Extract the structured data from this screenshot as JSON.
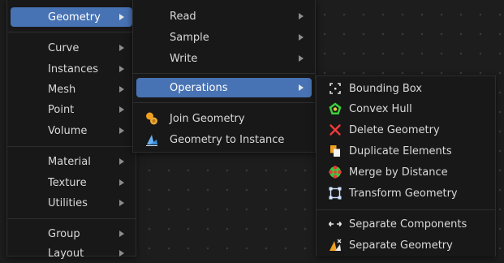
{
  "menu_main": {
    "items": [
      {
        "label": "Geometry",
        "active": true
      },
      {
        "label": "Curve"
      },
      {
        "label": "Instances"
      },
      {
        "label": "Mesh"
      },
      {
        "label": "Point"
      },
      {
        "label": "Volume"
      },
      {
        "label": "Material"
      },
      {
        "label": "Texture"
      },
      {
        "label": "Utilities"
      },
      {
        "label": "Group"
      },
      {
        "label": "Layout"
      }
    ]
  },
  "menu_geometry": {
    "items": [
      {
        "label": "Read"
      },
      {
        "label": "Sample"
      },
      {
        "label": "Write"
      },
      {
        "label": "Operations",
        "active": true
      },
      {
        "label": "Join Geometry",
        "icon": "join-geometry-icon"
      },
      {
        "label": "Geometry to Instance",
        "icon": "geometry-to-instance-icon"
      }
    ]
  },
  "menu_operations": {
    "items": [
      {
        "label": "Bounding Box",
        "icon": "bounding-box-icon"
      },
      {
        "label": "Convex Hull",
        "icon": "convex-hull-icon"
      },
      {
        "label": "Delete Geometry",
        "icon": "delete-x-icon"
      },
      {
        "label": "Duplicate Elements",
        "icon": "duplicate-icon"
      },
      {
        "label": "Merge by Distance",
        "icon": "merge-icon"
      },
      {
        "label": "Transform Geometry",
        "icon": "transform-icon"
      },
      {
        "label": "Separate Components",
        "icon": "separate-components-icon"
      },
      {
        "label": "Separate Geometry",
        "icon": "separate-geometry-icon"
      }
    ]
  },
  "colors": {
    "active_highlight": "#4772b3",
    "menu_background": "#181818",
    "editor_background": "#1d1d1d"
  }
}
